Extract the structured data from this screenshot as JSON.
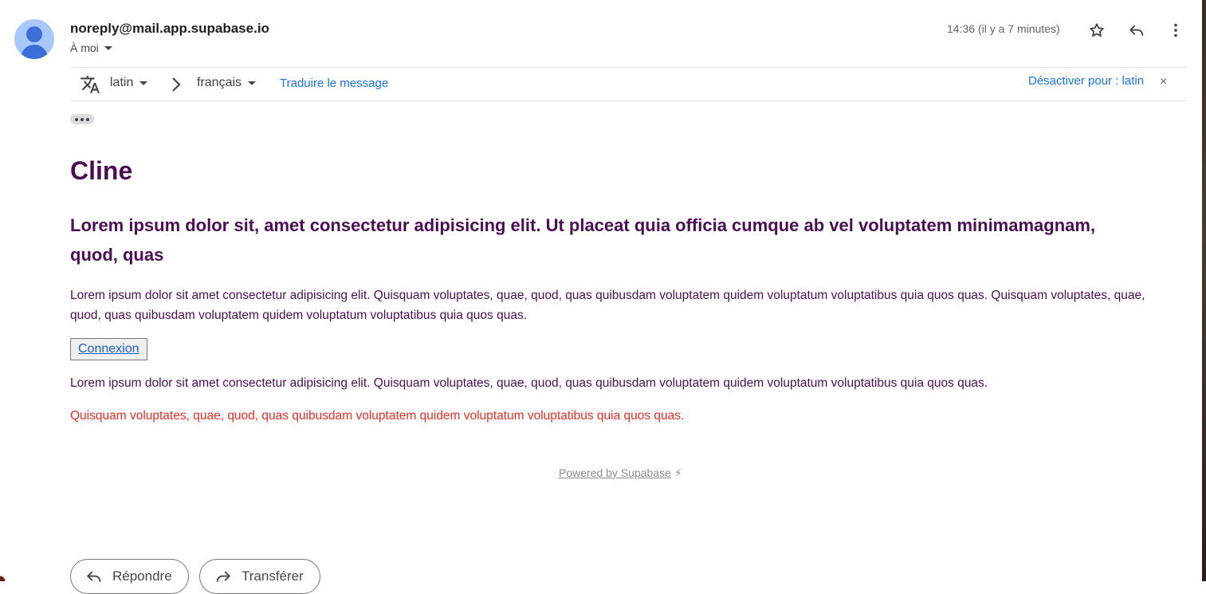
{
  "header": {
    "sender": "noreply@mail.app.supabase.io",
    "recipient": "À moi",
    "timestamp": "14:36 (il y a 7 minutes)",
    "icons": [
      "star-icon",
      "reply-icon",
      "more-vert-icon"
    ]
  },
  "translation_bar": {
    "source_language": "latin",
    "target_language": "français",
    "translate_link": "Traduire le message",
    "disable_link": "Désactiver pour : latin",
    "close_symbol": "×"
  },
  "email": {
    "title": "Cline",
    "subtitle": "Lorem ipsum dolor sit, amet consectetur adipisicing elit. Ut placeat quia officia cumque ab vel voluptatem minimamagnam, quod, quas",
    "paragraph1": "Lorem ipsum dolor sit amet consectetur adipisicing elit. Quisquam voluptates, quae, quod, quas quibusdam voluptatem quidem voluptatum voluptatibus quia quos quas. Quisquam voluptates, quae, quod, quas quibusdam voluptatem quidem voluptatum voluptatibus quia quos quas.",
    "button_label": "Connexion",
    "paragraph2": "Lorem ipsum dolor sit amet consectetur adipisicing elit. Quisquam voluptates, quae, quod, quas quibusdam voluptatem quidem voluptatum voluptatibus quia quos quas.",
    "paragraph3_red": "Quisquam voluptates, quae, quod, quas quibusdam voluptatem quidem voluptatum voluptatibus quia quos quas.",
    "powered_by": "Powered by Supabase",
    "bolt": "⚡"
  },
  "actions": {
    "reply_label": "Répondre",
    "forward_label": "Transférer"
  },
  "colors": {
    "title_purple": "#4b0e55",
    "warning_red": "#ee2a24",
    "link_blue": "#1a73e8",
    "avatar_bg": "#a8c7fa"
  }
}
